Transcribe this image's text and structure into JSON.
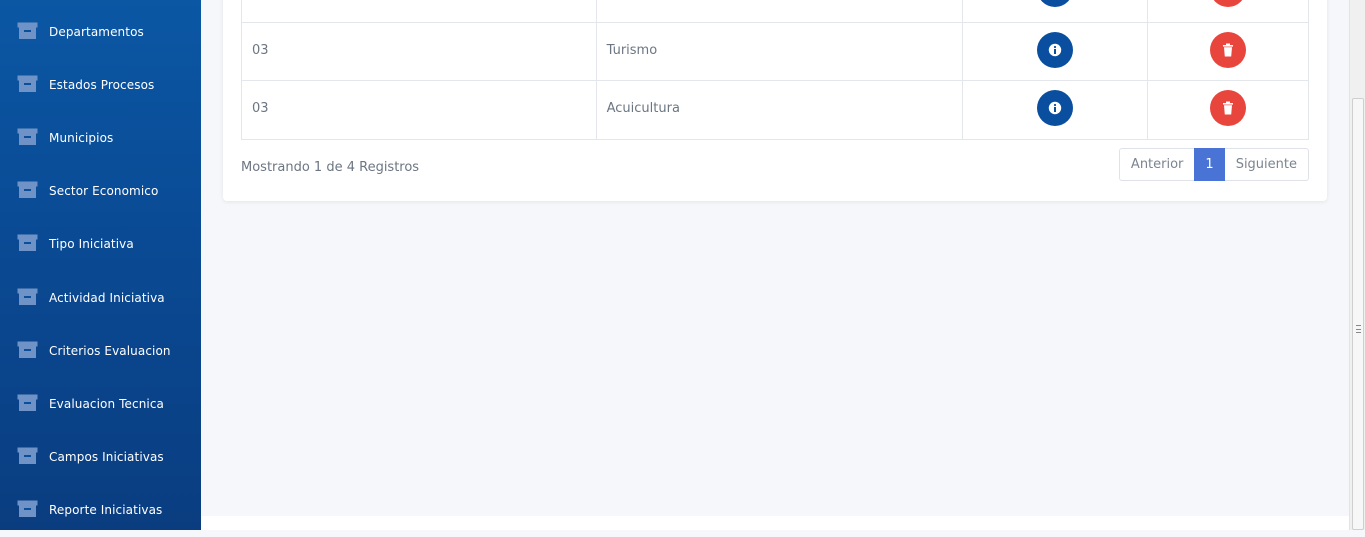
{
  "sidebar": {
    "items": [
      {
        "label": "Departamentos",
        "icon": "archive-icon"
      },
      {
        "label": "Estados Procesos",
        "icon": "archive-icon"
      },
      {
        "label": "Municipios",
        "icon": "archive-icon"
      },
      {
        "label": "Sector Economico",
        "icon": "archive-icon"
      },
      {
        "label": "Tipo Iniciativa",
        "icon": "archive-icon"
      },
      {
        "label": "Actividad Iniciativa",
        "icon": "archive-icon"
      },
      {
        "label": "Criterios Evaluacion",
        "icon": "archive-icon"
      },
      {
        "label": "Evaluacion Tecnica",
        "icon": "archive-icon"
      },
      {
        "label": "Campos Iniciativas",
        "icon": "archive-icon"
      },
      {
        "label": "Reporte Iniciativas",
        "icon": "archive-icon"
      }
    ]
  },
  "table": {
    "rows": [
      {
        "code": "",
        "name": "",
        "info_icon": "info-icon",
        "delete_icon": "trash-icon"
      },
      {
        "code": "03",
        "name": "Turismo",
        "info_icon": "info-icon",
        "delete_icon": "trash-icon"
      },
      {
        "code": "03",
        "name": "Acuicultura",
        "info_icon": "info-icon",
        "delete_icon": "trash-icon"
      }
    ]
  },
  "footer": {
    "record_info": "Mostrando 1 de 4 Registros"
  },
  "pagination": {
    "prev_label": "Anterior",
    "current_page": "1",
    "next_label": "Siguiente"
  },
  "colors": {
    "sidebar": "#0a4a94",
    "info_button": "#0a4ea0",
    "delete_button": "#e8453c",
    "active_page": "#4a73d6"
  }
}
